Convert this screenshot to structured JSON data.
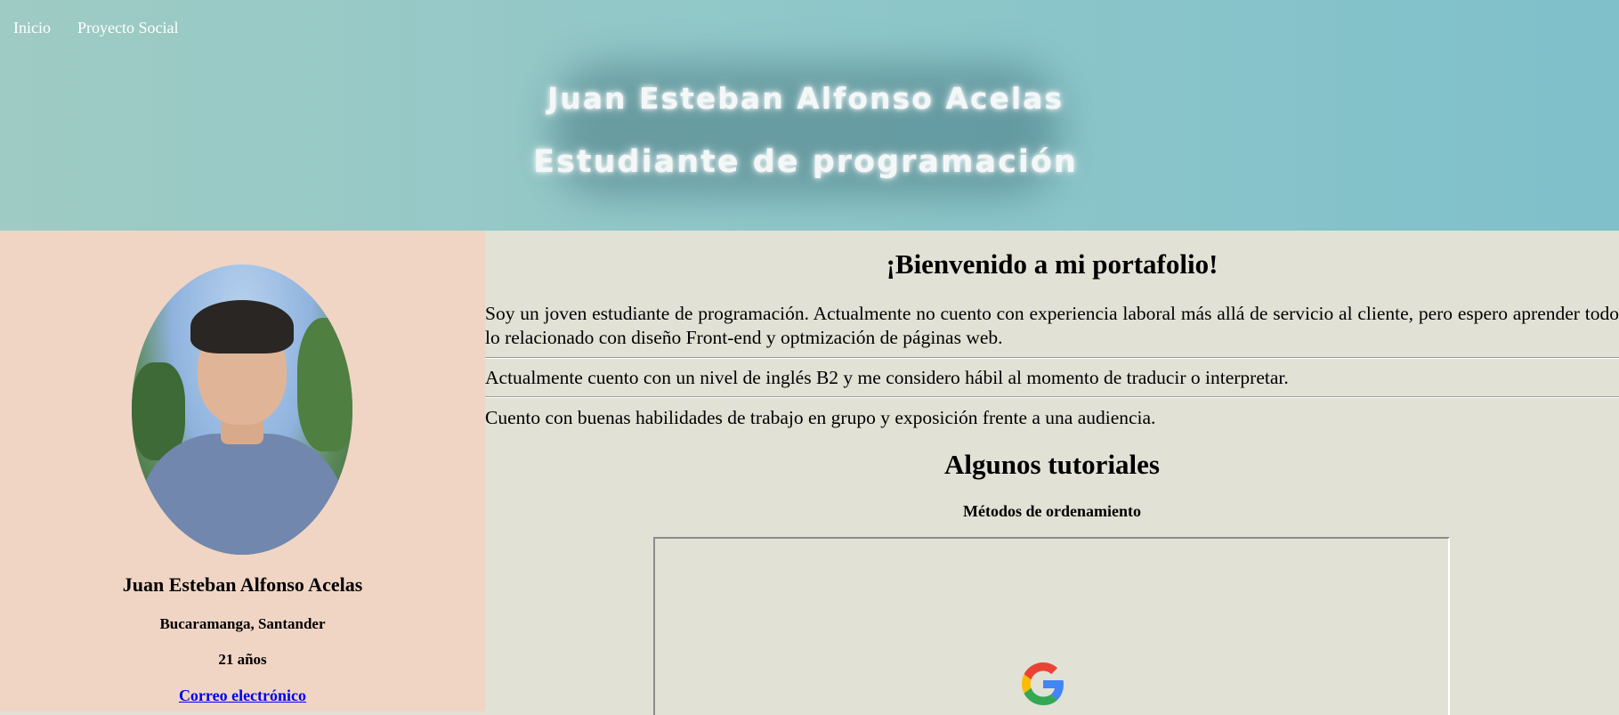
{
  "nav": {
    "items": [
      {
        "label": "Inicio"
      },
      {
        "label": "Proyecto Social"
      }
    ]
  },
  "hero": {
    "name": "Juan Esteban Alfonso Acelas",
    "role": "Estudiante de programación"
  },
  "sidebar": {
    "name": "Juan Esteban Alfonso Acelas",
    "location": "Bucaramanga, Santander",
    "age": "21 años",
    "email_link": "Correo electrónico"
  },
  "main": {
    "welcome_title": "¡Bienvenido a mi portafolio!",
    "paragraphs": [
      "Soy un joven estudiante de programación. Actualmente no cuento con experiencia laboral más allá de servicio al cliente, pero espero aprender todo lo relacionado con diseño Front-end y optmización de páginas web.",
      "Actualmente cuento con un nivel de inglés B2 y me considero hábil al momento de traducir o interpretar.",
      "Cuento con buenas habilidades de trabajo en grupo y exposición frente a una audiencia."
    ],
    "tutorials_title": "Algunos tutoriales",
    "tutorial_subtitle": "Métodos de ordenamiento",
    "embed_icon": "google-g-icon"
  },
  "colors": {
    "header_gradient_start": "#9ecbc4",
    "header_gradient_end": "#7fc0ca",
    "sidebar_bg": "#f0d5c5",
    "main_bg": "#e1e1d5",
    "link": "#0000ee"
  }
}
